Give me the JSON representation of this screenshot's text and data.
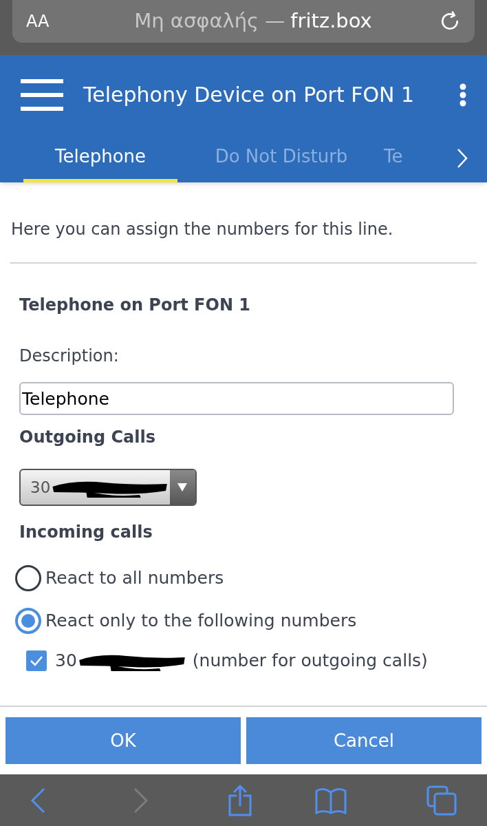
{
  "browser": {
    "text_size": "AA",
    "address_note": "Μη ασφαλής —",
    "address_host": "fritz.box"
  },
  "header": {
    "title": "Telephony Device on Port FON 1"
  },
  "tabs": [
    {
      "label": "Telephone",
      "selected": true
    },
    {
      "label": "Do Not Disturb",
      "selected": false
    },
    {
      "label": "Te",
      "selected": false
    }
  ],
  "intro": "Here you can assign the numbers for this line.",
  "section_title": "Telephone on Port FON 1",
  "description": {
    "label": "Description:",
    "value": "Telephone"
  },
  "outgoing": {
    "label": "Outgoing Calls",
    "value": "30"
  },
  "incoming": {
    "label": "Incoming calls",
    "options": [
      {
        "label": "React to all numbers",
        "selected": false
      },
      {
        "label": "React only to the following numbers",
        "selected": true
      }
    ],
    "numbers": [
      {
        "number": "30",
        "note": "(number for outgoing calls)",
        "checked": true
      }
    ]
  },
  "buttons": [
    "OK",
    "Cancel"
  ],
  "toolbar": {
    "back_disabled": false,
    "forward_disabled": true
  }
}
